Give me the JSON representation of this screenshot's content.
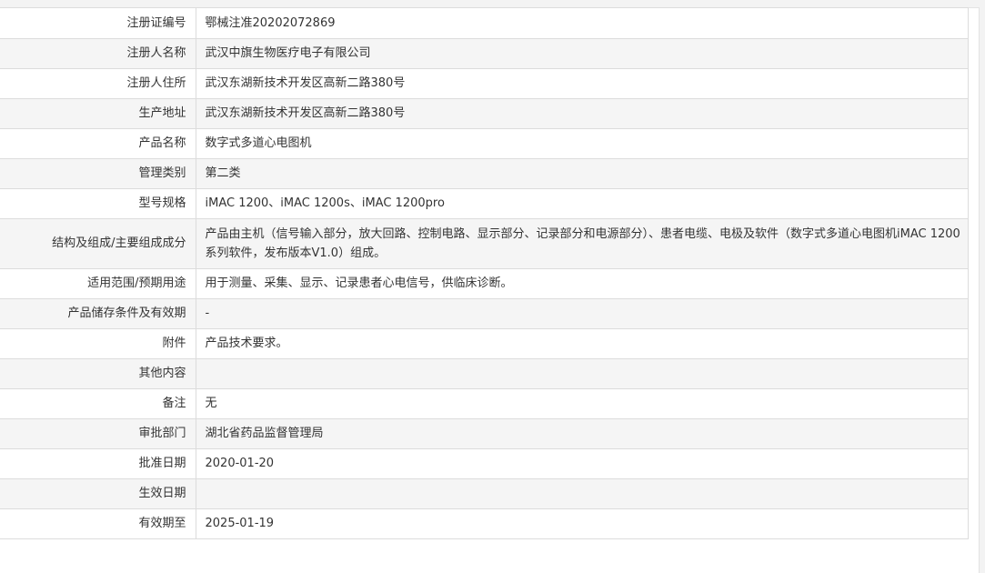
{
  "rows": [
    {
      "label": "注册证编号",
      "value": "鄂械注准20202072869"
    },
    {
      "label": "注册人名称",
      "value": "武汉中旗生物医疗电子有限公司"
    },
    {
      "label": "注册人住所",
      "value": "武汉东湖新技术开发区高新二路380号"
    },
    {
      "label": "生产地址",
      "value": "武汉东湖新技术开发区高新二路380号"
    },
    {
      "label": "产品名称",
      "value": "数字式多道心电图机"
    },
    {
      "label": "管理类别",
      "value": "第二类"
    },
    {
      "label": "型号规格",
      "value": "iMAC 1200、iMAC 1200s、iMAC 1200pro"
    },
    {
      "label": "结构及组成/主要组成成分",
      "value": "产品由主机（信号输入部分，放大回路、控制电路、显示部分、记录部分和电源部分）、患者电缆、电极及软件（数字式多道心电图机iMAC 1200系列软件，发布版本V1.0）组成。"
    },
    {
      "label": "适用范围/预期用途",
      "value": "用于测量、采集、显示、记录患者心电信号，供临床诊断。"
    },
    {
      "label": "产品储存条件及有效期",
      "value": "-"
    },
    {
      "label": "附件",
      "value": "产品技术要求。"
    },
    {
      "label": "其他内容",
      "value": ""
    },
    {
      "label": "备注",
      "value": "无"
    },
    {
      "label": "审批部门",
      "value": "湖北省药品监督管理局"
    },
    {
      "label": "批准日期",
      "value": "2020-01-20"
    },
    {
      "label": "生效日期",
      "value": ""
    },
    {
      "label": "有效期至",
      "value": "2025-01-19"
    }
  ]
}
